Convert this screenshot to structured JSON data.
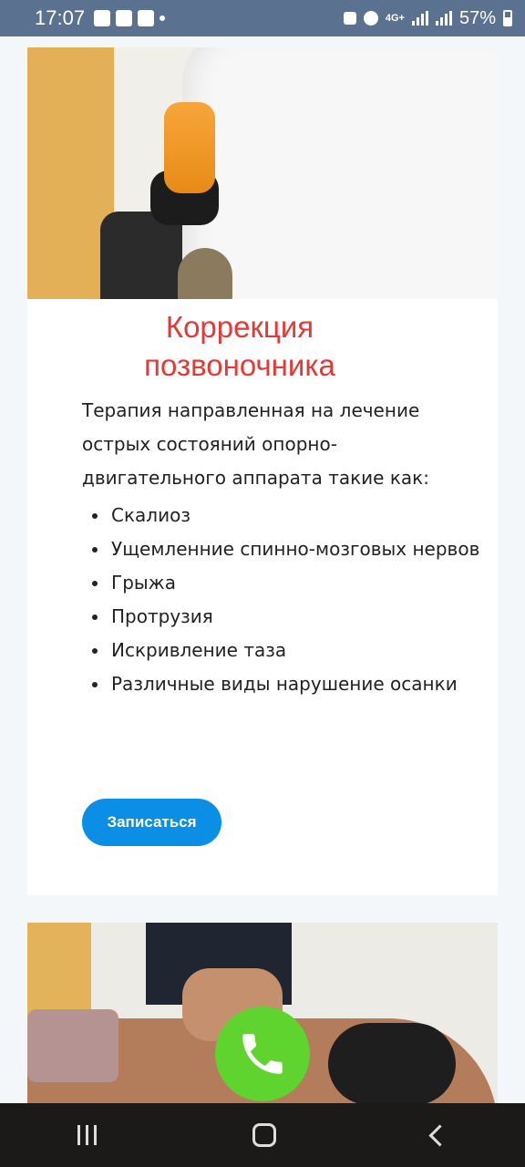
{
  "status_bar": {
    "time": "17:07",
    "network": "4G+",
    "battery": "57%"
  },
  "card1": {
    "heading_line1": "Коррекция",
    "heading_line2": "позвоночника",
    "description": "Терапия направленная на лечение острых состояний опорно-двигательного аппарата такие как:",
    "items": [
      "Скалиоз",
      "Ущемленние спинно-мозговых нервов",
      "Грыжа",
      "Протрузия",
      "Искривление таза",
      "Различные виды нарушение осанки"
    ],
    "button_label": "Записаться"
  },
  "colors": {
    "heading": "#e53935",
    "button": "#0a8ee6",
    "call_button": "#5fd32e"
  },
  "icons": {
    "call": "phone-icon",
    "nav_recents": "recents-icon",
    "nav_home": "home-icon",
    "nav_back": "back-icon"
  }
}
